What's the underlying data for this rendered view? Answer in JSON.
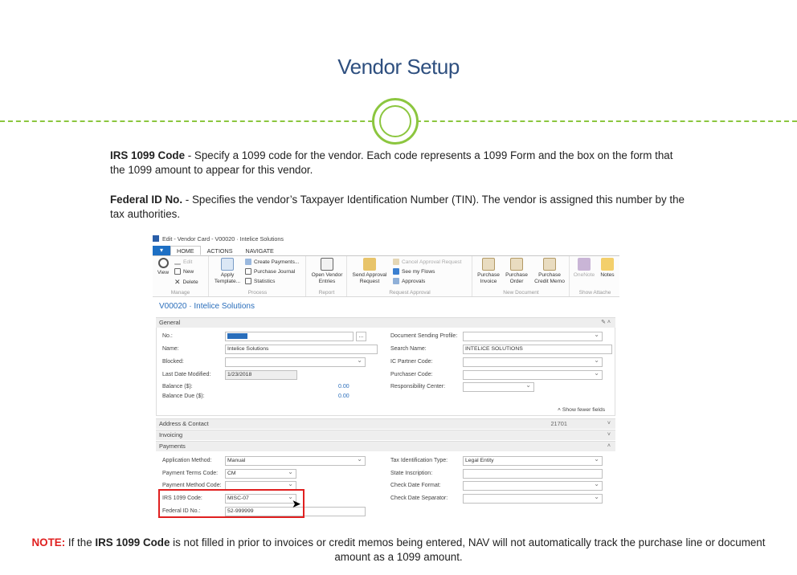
{
  "slide": {
    "title": "Vendor Setup",
    "para1_bold": "IRS 1099 Code",
    "para1_text": " - Specify a 1099 code for the vendor. Each code represents a 1099 Form and the box on the form that the 1099 amount to appear for this vendor.",
    "para2_bold": "Federal ID No.",
    "para2_text": " - Specifies the vendor’s Taxpayer Identification Number (TIN). The vendor is assigned this number by the tax authorities.",
    "note_label": "NOTE:",
    "note_pre": "  If the ",
    "note_bold": "IRS 1099 Code",
    "note_post": " is not filled in prior to invoices or credit memos being entered, NAV will not automatically track the purchase line or document amount as a 1099 amount.",
    "accent_green": "#8cc63f",
    "title_color": "#2e4f7f"
  },
  "window": {
    "title": "Edit - Vendor Card - V00020 · Intelice Solutions",
    "tabs": [
      "HOME",
      "ACTIONS",
      "NAVIGATE"
    ],
    "ribbon": {
      "manage": {
        "label": "Manage",
        "view": "View",
        "edit": "Edit",
        "new": "New",
        "delete": "Delete"
      },
      "process": {
        "label": "Process",
        "apply_template_1": "Apply",
        "apply_template_2": "Template...",
        "create_payments": "Create Payments...",
        "purchase_journal": "Purchase Journal",
        "statistics": "Statistics"
      },
      "report": {
        "label": "Report",
        "open_vendor_1": "Open Vendor",
        "open_vendor_2": "Entries"
      },
      "approval": {
        "label": "Request Approval",
        "send_1": "Send Approval",
        "send_2": "Request",
        "cancel": "Cancel Approval Request",
        "see_flows": "See my Flows",
        "approvals": "Approvals"
      },
      "new_document": {
        "label": "New Document",
        "invoice_1": "Purchase",
        "invoice_2": "Invoice",
        "order_1": "Purchase",
        "order_2": "Order",
        "credit_1": "Purchase",
        "credit_2": "Credit Memo"
      },
      "show_attached": {
        "label": "Show Attache",
        "onenote": "OneNote",
        "notes": "Notes"
      }
    },
    "vendor_title": "V00020 · Intelice Solutions",
    "general": {
      "header": "General",
      "no_label": "No.:",
      "no_value": "V00020",
      "name_label": "Name:",
      "name_value": "Intelice Solutions",
      "blocked_label": "Blocked:",
      "last_modified_label": "Last Date Modified:",
      "last_modified_value": "1/23/2018",
      "balance_label": "Balance ($):",
      "balance_value": "0.00",
      "balance_due_label": "Balance Due ($):",
      "balance_due_value": "0.00",
      "doc_sending_label": "Document Sending Profile:",
      "search_name_label": "Search Name:",
      "search_name_value": "INTELICE SOLUTIONS",
      "ic_partner_label": "IC Partner Code:",
      "purchaser_label": "Purchaser Code:",
      "resp_center_label": "Responsibility Center:",
      "show_fewer": "Show fewer fields"
    },
    "address_header": "Address & Contact",
    "address_value": "21701",
    "invoicing_header": "Invoicing",
    "payments": {
      "header": "Payments",
      "app_method_label": "Application Method:",
      "app_method_value": "Manual",
      "terms_label": "Payment Terms Code:",
      "terms_value": "CM",
      "method_label": "Payment Method Code:",
      "irs_label": "IRS 1099 Code:",
      "irs_value": "MISC-07",
      "fed_id_label": "Federal ID No.:",
      "fed_id_value": "52-999999",
      "tax_id_type_label": "Tax Identification Type:",
      "tax_id_type_value": "Legal Entity",
      "state_insc_label": "State Inscription:",
      "check_format_label": "Check Date Format:",
      "check_sep_label": "Check Date Separator:"
    }
  }
}
